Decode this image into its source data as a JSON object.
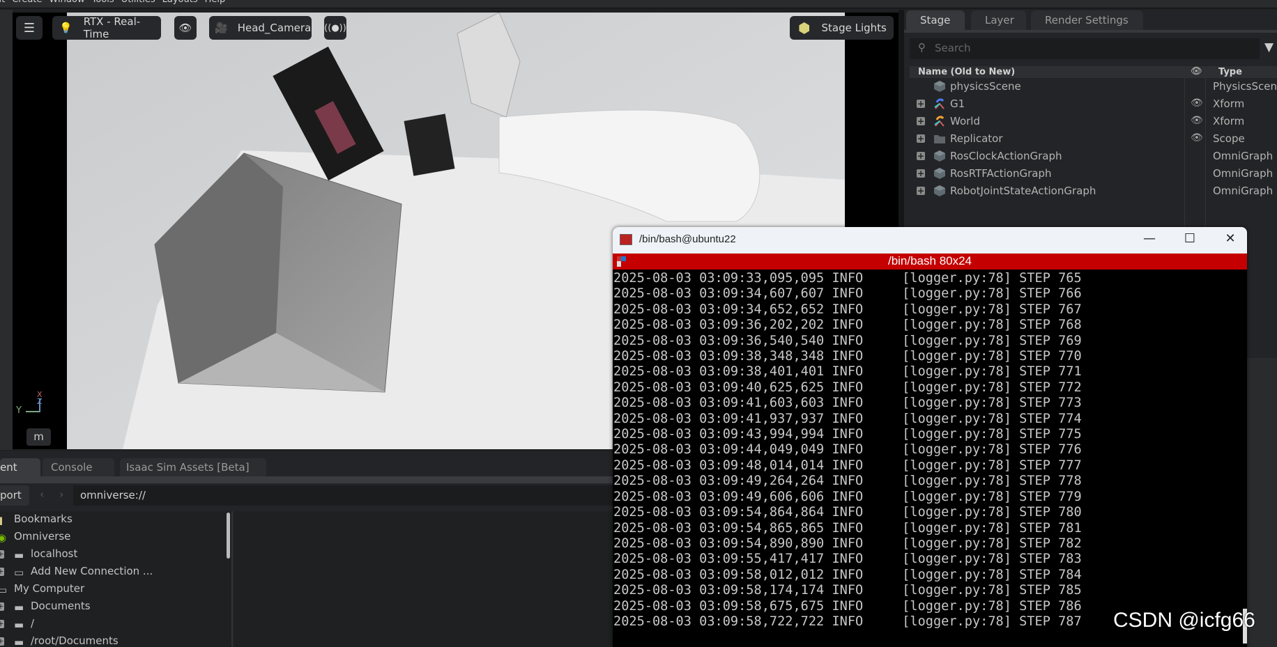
{
  "menu": [
    "Edit",
    "Create",
    "Window",
    "Tools",
    "Utilities",
    "Layouts",
    "Help"
  ],
  "viewport": {
    "renderer_label": "RTX - Real-Time",
    "camera_label": "Head_Camera",
    "lights_label": "Stage Lights",
    "units_label": "m",
    "axis_labels": {
      "y": "Y",
      "z": "Z",
      "x": "X"
    }
  },
  "stage": {
    "tabs": [
      "Stage",
      "Layer",
      "Render Settings"
    ],
    "search_placeholder": "Search",
    "columns": {
      "name": "Name (Old to New)",
      "type": "Type"
    },
    "rows": [
      {
        "name": "physicsScene",
        "type": "PhysicsScene",
        "icon": "cube-icon",
        "expandable": false,
        "visible_toggle": false
      },
      {
        "name": "G1",
        "type": "Xform",
        "icon": "xform-blue-icon",
        "expandable": true,
        "visible_toggle": true
      },
      {
        "name": "World",
        "type": "Xform",
        "icon": "xform-orange-icon",
        "expandable": true,
        "visible_toggle": true
      },
      {
        "name": "Replicator",
        "type": "Scope",
        "icon": "folder-icon",
        "expandable": true,
        "visible_toggle": true
      },
      {
        "name": "RosClockActionGraph",
        "type": "OmniGraph",
        "icon": "cube-icon",
        "expandable": true,
        "visible_toggle": false
      },
      {
        "name": "RosRTFActionGraph",
        "type": "OmniGraph",
        "icon": "cube-icon",
        "expandable": true,
        "visible_toggle": false
      },
      {
        "name": "RobotJointStateActionGraph",
        "type": "OmniGraph",
        "icon": "cube-icon",
        "expandable": true,
        "visible_toggle": false
      }
    ]
  },
  "content": {
    "tabs": [
      "ent",
      "Console",
      "Isaac Sim Assets [Beta]"
    ],
    "import_label": "port",
    "path": "omniverse://",
    "tree": [
      {
        "label": "Bookmarks",
        "icon": "bookmark-icon",
        "expandable": false,
        "indent": 0
      },
      {
        "label": "Omniverse",
        "icon": "omniverse-icon",
        "expandable": false,
        "indent": 0
      },
      {
        "label": "localhost",
        "icon": "server-icon",
        "expandable": true,
        "indent": 1
      },
      {
        "label": "Add New Connection ...",
        "icon": "add-connection-icon",
        "expandable": true,
        "indent": 1
      },
      {
        "label": "My Computer",
        "icon": "computer-icon",
        "expandable": false,
        "indent": 0
      },
      {
        "label": "Documents",
        "icon": "drive-icon",
        "expandable": true,
        "indent": 1
      },
      {
        "label": "/",
        "icon": "drive-icon",
        "expandable": true,
        "indent": 1
      },
      {
        "label": "/root/Documents",
        "icon": "drive-icon",
        "expandable": true,
        "indent": 1
      }
    ]
  },
  "terminal": {
    "window_title": "/bin/bash@ubuntu22",
    "session_title": "/bin/bash 80x24",
    "lines": [
      "2025-08-03 03:09:33,095,095 INFO     [logger.py:78] STEP 765",
      "2025-08-03 03:09:34,607,607 INFO     [logger.py:78] STEP 766",
      "2025-08-03 03:09:34,652,652 INFO     [logger.py:78] STEP 767",
      "2025-08-03 03:09:36,202,202 INFO     [logger.py:78] STEP 768",
      "2025-08-03 03:09:36,540,540 INFO     [logger.py:78] STEP 769",
      "2025-08-03 03:09:38,348,348 INFO     [logger.py:78] STEP 770",
      "2025-08-03 03:09:38,401,401 INFO     [logger.py:78] STEP 771",
      "2025-08-03 03:09:40,625,625 INFO     [logger.py:78] STEP 772",
      "2025-08-03 03:09:41,603,603 INFO     [logger.py:78] STEP 773",
      "2025-08-03 03:09:41,937,937 INFO     [logger.py:78] STEP 774",
      "2025-08-03 03:09:43,994,994 INFO     [logger.py:78] STEP 775",
      "2025-08-03 03:09:44,049,049 INFO     [logger.py:78] STEP 776",
      "2025-08-03 03:09:48,014,014 INFO     [logger.py:78] STEP 777",
      "2025-08-03 03:09:49,264,264 INFO     [logger.py:78] STEP 778",
      "2025-08-03 03:09:49,606,606 INFO     [logger.py:78] STEP 779",
      "2025-08-03 03:09:54,864,864 INFO     [logger.py:78] STEP 780",
      "2025-08-03 03:09:54,865,865 INFO     [logger.py:78] STEP 781",
      "2025-08-03 03:09:54,890,890 INFO     [logger.py:78] STEP 782",
      "2025-08-03 03:09:55,417,417 INFO     [logger.py:78] STEP 783",
      "2025-08-03 03:09:58,012,012 INFO     [logger.py:78] STEP 784",
      "2025-08-03 03:09:58,174,174 INFO     [logger.py:78] STEP 785",
      "2025-08-03 03:09:58,675,675 INFO     [logger.py:78] STEP 786",
      "2025-08-03 03:09:58,722,722 INFO     [logger.py:78] STEP 787"
    ],
    "controls": {
      "minimize": "—",
      "maximize": "☐",
      "close": "✕"
    }
  },
  "watermark": "CSDN @icfg66",
  "colors": {
    "terminal_bar": "#c40000",
    "accent_green": "#76b900"
  }
}
